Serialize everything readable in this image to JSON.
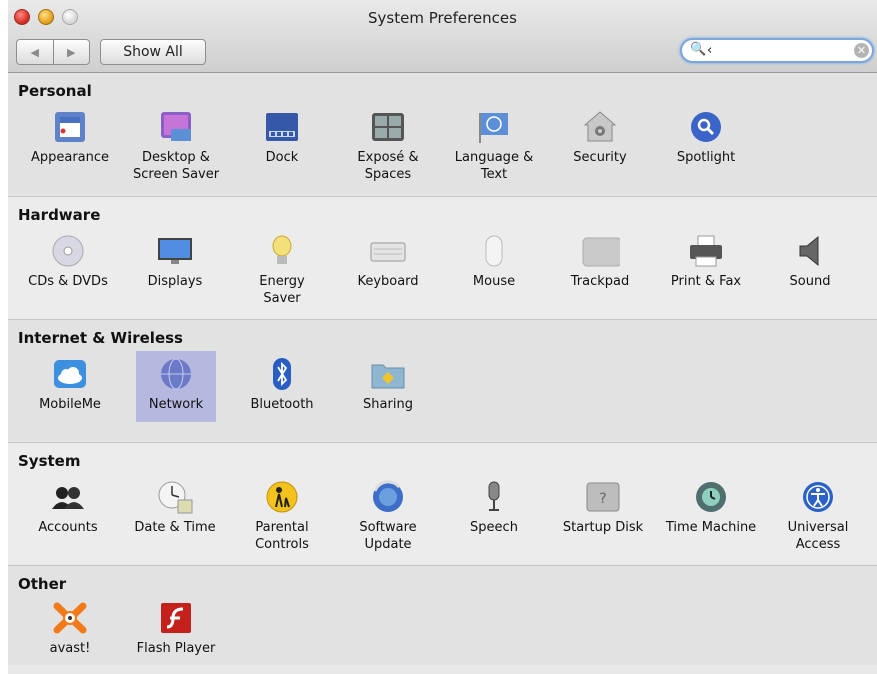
{
  "window": {
    "title": "System Preferences",
    "back_label": "◀",
    "forward_label": "▶",
    "show_all_label": "Show All",
    "search_icon": "🔍",
    "search_value": "‹",
    "search_clear": "✕"
  },
  "sections": [
    {
      "title": "Personal",
      "items": [
        {
          "label": "Appearance",
          "icon": "appearance-icon"
        },
        {
          "label": "Desktop &\nScreen Saver",
          "icon": "desktop-icon"
        },
        {
          "label": "Dock",
          "icon": "dock-icon"
        },
        {
          "label": "Exposé &\nSpaces",
          "icon": "expose-icon"
        },
        {
          "label": "Language &\nText",
          "icon": "language-icon"
        },
        {
          "label": "Security",
          "icon": "security-icon"
        },
        {
          "label": "Spotlight",
          "icon": "spotlight-icon"
        }
      ]
    },
    {
      "title": "Hardware",
      "items": [
        {
          "label": "CDs & DVDs",
          "icon": "cd-icon"
        },
        {
          "label": "Displays",
          "icon": "display-icon"
        },
        {
          "label": "Energy\nSaver",
          "icon": "energy-icon"
        },
        {
          "label": "Keyboard",
          "icon": "keyboard-icon"
        },
        {
          "label": "Mouse",
          "icon": "mouse-icon"
        },
        {
          "label": "Trackpad",
          "icon": "trackpad-icon"
        },
        {
          "label": "Print & Fax",
          "icon": "printer-icon"
        },
        {
          "label": "Sound",
          "icon": "speaker-icon"
        }
      ]
    },
    {
      "title": "Internet & Wireless",
      "items": [
        {
          "label": "MobileMe",
          "icon": "cloud-icon"
        },
        {
          "label": "Network",
          "icon": "globe-icon"
        },
        {
          "label": "Bluetooth",
          "icon": "bluetooth-icon"
        },
        {
          "label": "Sharing",
          "icon": "folder-icon"
        }
      ]
    },
    {
      "title": "System",
      "items": [
        {
          "label": "Accounts",
          "icon": "users-icon"
        },
        {
          "label": "Date & Time",
          "icon": "clock-icon"
        },
        {
          "label": "Parental\nControls",
          "icon": "parental-icon"
        },
        {
          "label": "Software\nUpdate",
          "icon": "update-icon"
        },
        {
          "label": "Speech",
          "icon": "microphone-icon"
        },
        {
          "label": "Startup Disk",
          "icon": "disk-icon"
        },
        {
          "label": "Time Machine",
          "icon": "time-machine-icon"
        },
        {
          "label": "Universal\nAccess",
          "icon": "accessibility-icon"
        }
      ]
    },
    {
      "title": "Other",
      "items": [
        {
          "label": "avast!",
          "icon": "avast-icon"
        },
        {
          "label": "Flash Player",
          "icon": "flash-icon"
        }
      ]
    }
  ]
}
